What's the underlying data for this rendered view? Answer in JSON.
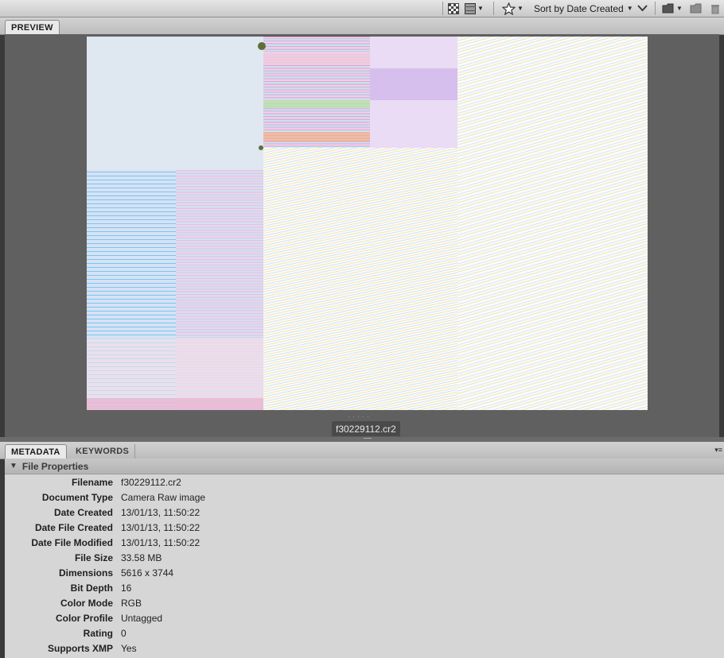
{
  "toolbar": {
    "sort_label": "Sort by Date Created",
    "icons": [
      "checker-icon",
      "grid-icon",
      "star-filter-icon",
      "folder-icon",
      "new-folder-icon",
      "trash-icon"
    ]
  },
  "preview_panel": {
    "tabs": [
      {
        "label": "PREVIEW",
        "active": true
      }
    ],
    "filename": "f30229112.cr2"
  },
  "metadata_panel": {
    "tabs": [
      {
        "label": "METADATA",
        "active": true
      },
      {
        "label": "KEYWORDS",
        "active": false
      }
    ],
    "section_title": "File Properties",
    "rows": [
      {
        "label": "Filename",
        "value": "f30229112.cr2"
      },
      {
        "label": "Document Type",
        "value": "Camera Raw image"
      },
      {
        "label": "Date Created",
        "value": "13/01/13, 11:50:22"
      },
      {
        "label": "Date File Created",
        "value": "13/01/13, 11:50:22"
      },
      {
        "label": "Date File Modified",
        "value": "13/01/13, 11:50:22"
      },
      {
        "label": "File Size",
        "value": "33.58 MB"
      },
      {
        "label": "Dimensions",
        "value": "5616 x 3744"
      },
      {
        "label": "Bit Depth",
        "value": "16"
      },
      {
        "label": "Color Mode",
        "value": "RGB"
      },
      {
        "label": "Color Profile",
        "value": "Untagged"
      },
      {
        "label": "Rating",
        "value": "0"
      },
      {
        "label": "Supports XMP",
        "value": "Yes"
      }
    ]
  }
}
